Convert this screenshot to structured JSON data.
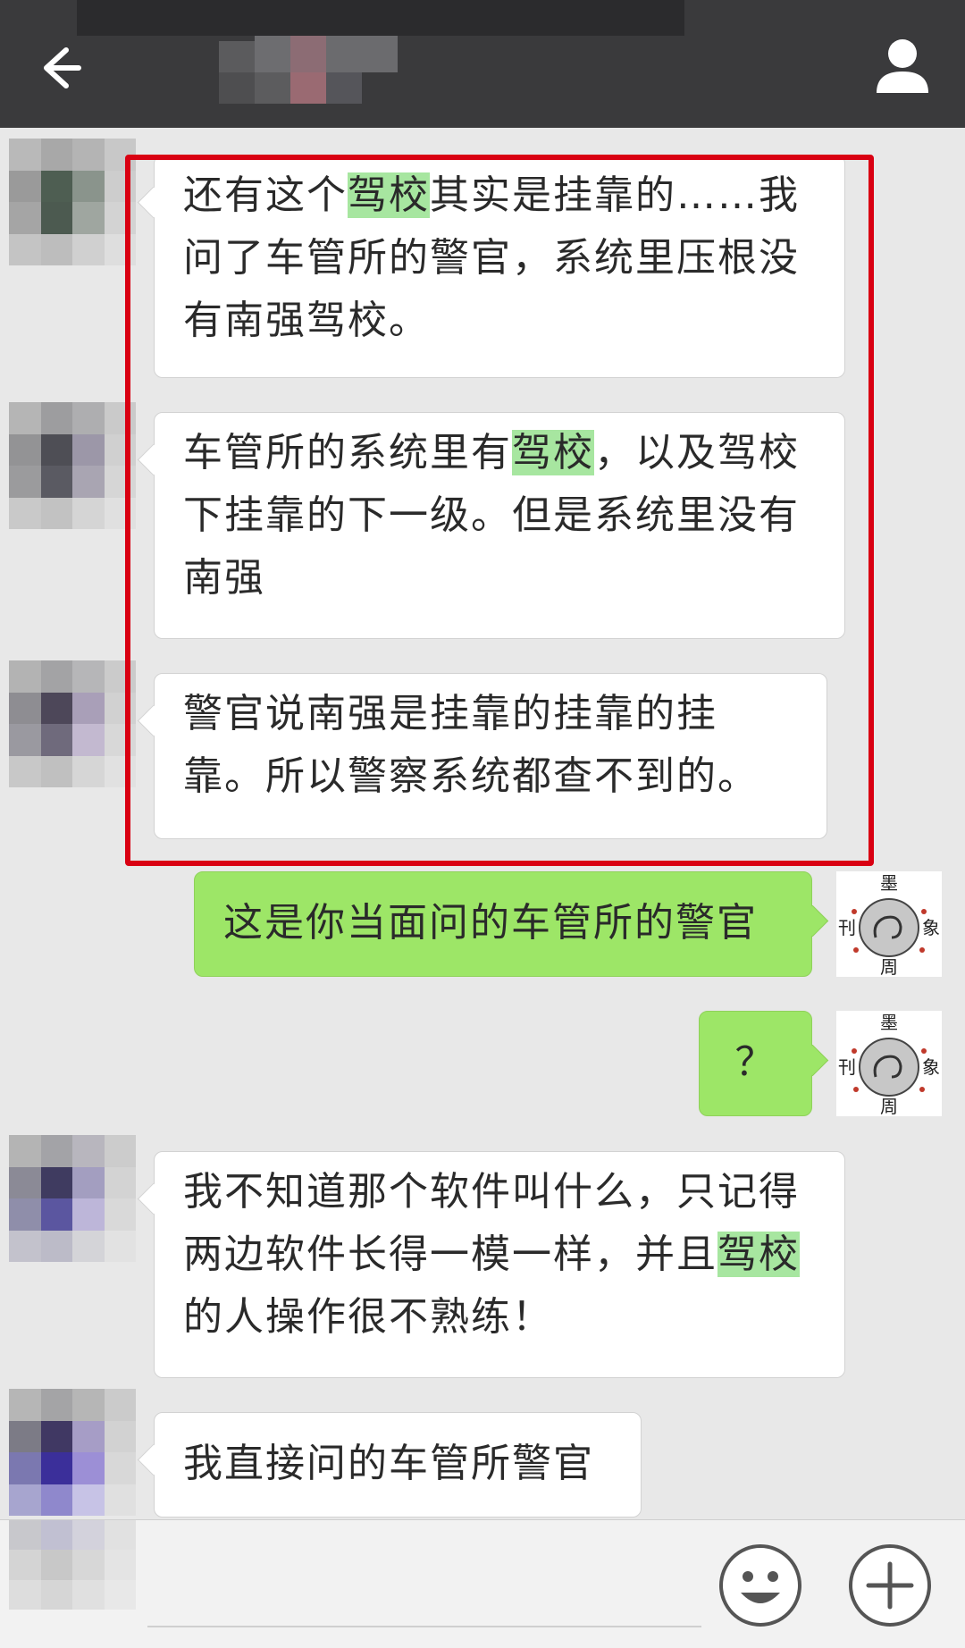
{
  "header": {
    "back_icon": "arrow-left-icon",
    "profile_icon": "person-icon"
  },
  "messages": [
    {
      "side": "left",
      "parts": [
        "还有这个",
        "驾校",
        "其实是挂靠的……我问了车管所的警官，系统里压根没有南强驾校。"
      ]
    },
    {
      "side": "left",
      "parts": [
        "车管所的系统里有",
        "驾校",
        "，以及驾校下挂靠的下一级。但是系统里没有南强"
      ]
    },
    {
      "side": "left",
      "text": "警官说南强是挂靠的挂靠的挂靠。所以警察系统都查不到的。"
    },
    {
      "side": "right",
      "text": "这是你当面问的车管所的警官"
    },
    {
      "side": "right",
      "text": "？"
    },
    {
      "side": "left",
      "parts": [
        "我不知道那个软件叫什么，只记得两边软件长得一模一样，并且",
        "驾校",
        "的人操作很不熟练！"
      ]
    },
    {
      "side": "left",
      "text": "我直接问的车管所警官"
    }
  ],
  "my_avatar": {
    "chars": [
      "墨",
      "刊",
      "象",
      "周"
    ],
    "icon": "elephant-icon"
  },
  "input_bar": {
    "emoji_icon": "smiley-icon",
    "plus_icon": "plus-icon"
  },
  "colors": {
    "header_bg": "#3a3a3c",
    "chat_bg": "#e8e8e8",
    "sent_bubble": "#9de667",
    "highlight": "#a7e6a0",
    "annotation_frame": "#d90012"
  }
}
